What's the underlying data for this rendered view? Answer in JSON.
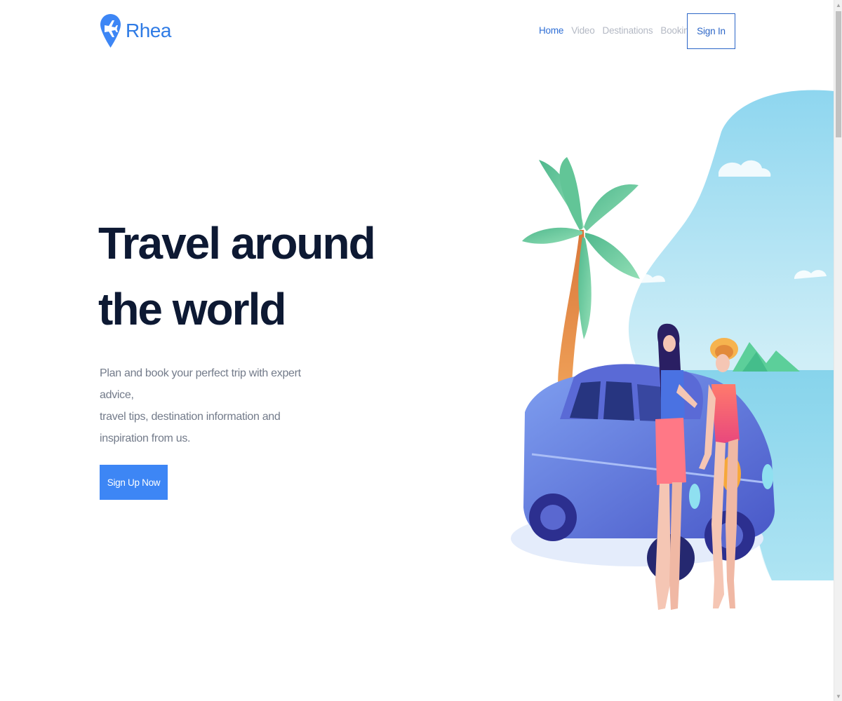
{
  "brand": {
    "name": "Rhea",
    "icon": "plane-icon",
    "color": "#2f7be5"
  },
  "nav": {
    "items": [
      {
        "label": "Home",
        "active": true
      },
      {
        "label": "Video",
        "active": false
      },
      {
        "label": "Destinations",
        "active": false
      },
      {
        "label": "Booking",
        "active": false
      }
    ],
    "signin_label": "Sign In"
  },
  "hero": {
    "title_line1": "Travel around",
    "title_line2": "the world",
    "subtitle_line1": "Plan and book your perfect trip with expert advice,",
    "subtitle_line2": "travel tips, destination information and",
    "subtitle_line3": "inspiration from us.",
    "cta_label": "Sign Up Now"
  },
  "colors": {
    "accent": "#3d86f5",
    "heading": "#0d1933",
    "nav_active": "#2f6fd6",
    "nav_inactive": "#b4b9c4"
  }
}
